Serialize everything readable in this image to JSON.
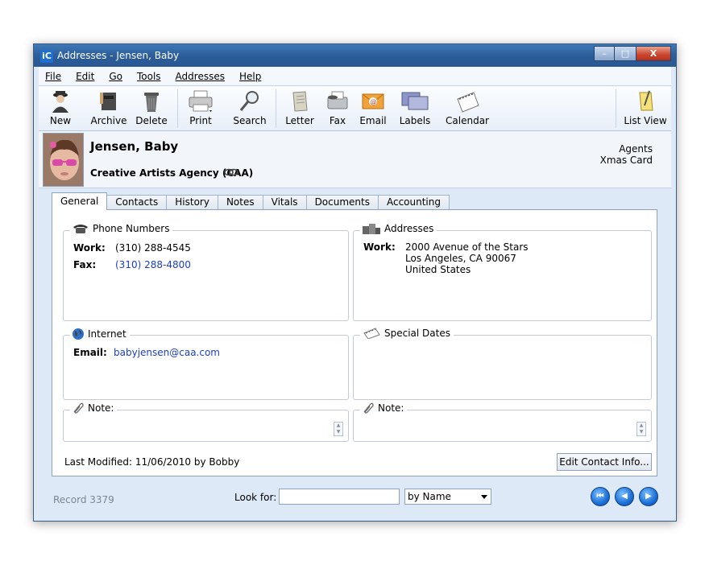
{
  "window": {
    "title": "Addresses - Jensen, Baby",
    "app_icon": "iC",
    "buttons": {
      "minimize": "–",
      "maximize": "□",
      "close": "X"
    }
  },
  "menu": [
    "File",
    "Edit",
    "Go",
    "Tools",
    "Addresses",
    "Help"
  ],
  "toolbar": {
    "new": "New",
    "archive": "Archive",
    "delete": "Delete",
    "print": "Print",
    "search": "Search",
    "letter": "Letter",
    "fax": "Fax",
    "email": "Email",
    "labels": "Labels",
    "calendar": "Calendar",
    "list_view": "List View"
  },
  "contact": {
    "name": "Jensen, Baby",
    "company": "Creative Artists Agency (CAA)",
    "categories": [
      "Agents",
      "Xmas Card"
    ]
  },
  "tabs": [
    "General",
    "Contacts",
    "History",
    "Notes",
    "Vitals",
    "Documents",
    "Accounting"
  ],
  "general": {
    "phone": {
      "title": "Phone Numbers",
      "work_label": "Work:",
      "work": "(310) 288-4545",
      "fax_label": "Fax:",
      "fax": "(310) 288-4800"
    },
    "addresses": {
      "title": "Addresses",
      "work_label": "Work:",
      "line1": "2000 Avenue of the Stars",
      "line2": "Los Angeles, CA 90067",
      "line3": "United States"
    },
    "internet": {
      "title": "Internet",
      "email_label": "Email:",
      "email": "babyjensen@caa.com"
    },
    "special_dates": {
      "title": "Special Dates"
    },
    "note_left": "Note:",
    "note_right": "Note:",
    "last_modified": "Last Modified: 11/06/2010 by Bobby",
    "edit_button": "Edit Contact Info..."
  },
  "footer": {
    "record": "Record 3379",
    "look_for_label": "Look for:",
    "look_for_value": "",
    "by_select": "by Name"
  },
  "icons": {
    "nav_first": "⏮",
    "nav_prev": "◀",
    "nav_next": "▶"
  }
}
